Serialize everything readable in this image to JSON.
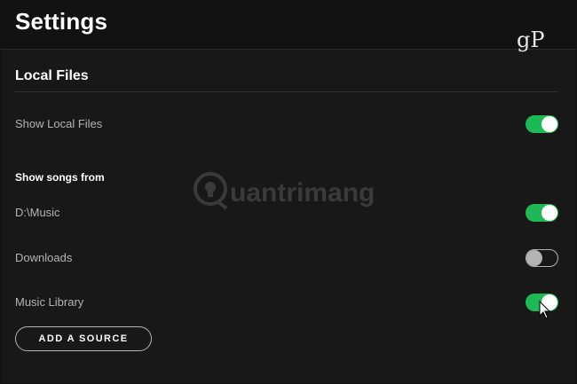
{
  "header": {
    "title": "Settings",
    "logo_text": "gP"
  },
  "local_files": {
    "section_title": "Local Files",
    "show_local_files": {
      "label": "Show Local Files",
      "enabled": true
    }
  },
  "show_songs_from": {
    "title": "Show songs from",
    "sources": [
      {
        "label": "D:\\Music",
        "enabled": true
      },
      {
        "label": "Downloads",
        "enabled": false
      },
      {
        "label": "Music Library",
        "enabled": true
      }
    ]
  },
  "add_source_button": {
    "label": "ADD A SOURCE"
  },
  "watermark": {
    "text": "uantrimang"
  },
  "colors": {
    "accent": "#1db954",
    "background": "#181818",
    "header_background": "#121212",
    "secondary_text": "#b3b3b3"
  }
}
